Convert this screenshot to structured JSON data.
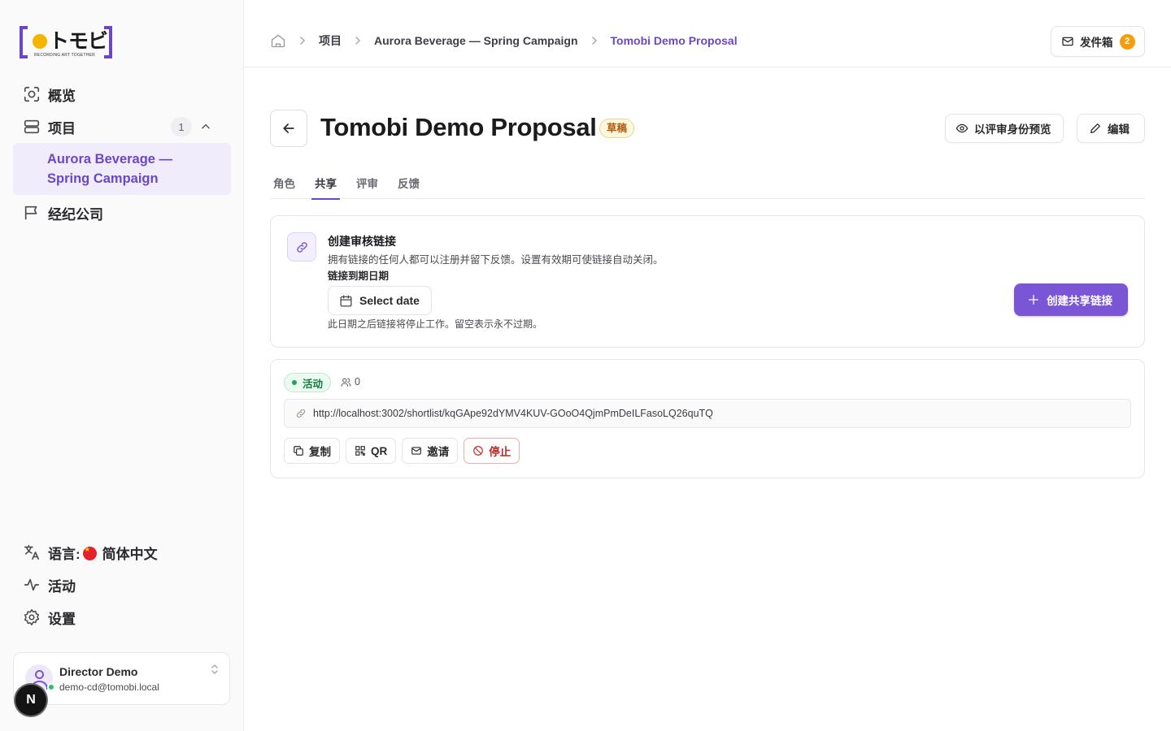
{
  "brand": {
    "wordmark": "トモビ",
    "tagline": "RECORDING ART TOGETHER",
    "accent": "#6b47c7",
    "dot_color": "#f5b400"
  },
  "sidebar": {
    "items": [
      {
        "label": "概览",
        "icon": "scan-icon"
      },
      {
        "label": "项目",
        "icon": "layers-icon",
        "badge": "1"
      },
      {
        "label": "经纪公司",
        "icon": "flag-icon"
      }
    ],
    "sub_item": "Aurora Beverage — Spring Campaign",
    "bottom": {
      "language_label": "语言:",
      "language_value": "简体中文",
      "activity": "活动",
      "settings": "设置"
    },
    "user": {
      "name": "Director Demo",
      "email": "demo-cd@tomobi.local"
    },
    "next_badge": "N"
  },
  "header": {
    "breadcrumb": [
      "项目",
      "Aurora Beverage — Spring Campaign",
      "Tomobi Demo Proposal"
    ],
    "outbox_label": "发件箱",
    "outbox_count": "2"
  },
  "main": {
    "title": "Tomobi Demo Proposal",
    "status_badge": "草稿",
    "preview_label": "以评审身份预览",
    "edit_label": "编辑",
    "tabs": [
      {
        "label": "角色",
        "active": false
      },
      {
        "label": "共享",
        "active": true
      },
      {
        "label": "评审",
        "active": false
      },
      {
        "label": "反馈",
        "active": false
      }
    ],
    "create": {
      "title": "创建审核链接",
      "description": "拥有链接的任何人都可以注册并留下反馈。设置有效期可使链接自动关闭。",
      "expiry_label": "链接到期日期",
      "date_placeholder": "Select date",
      "expiry_hint": "此日期之后链接将停止工作。留空表示永不过期。",
      "button": "创建共享链接"
    },
    "link": {
      "status": "活动",
      "viewer_count": "0",
      "url": "http://localhost:3002/shortlist/kqGApe92dYMV4KUV-GOoO4QjmPmDeILFasoLQ26quTQ",
      "actions": {
        "copy": "复制",
        "qr": "QR",
        "invite": "邀请",
        "stop": "停止"
      }
    }
  },
  "colors": {
    "primary": "#7a55d6",
    "active_green": "#22a354",
    "danger": "#c22727",
    "draft_amber": "#b45a0a",
    "badge_orange": "#f59e0b"
  }
}
